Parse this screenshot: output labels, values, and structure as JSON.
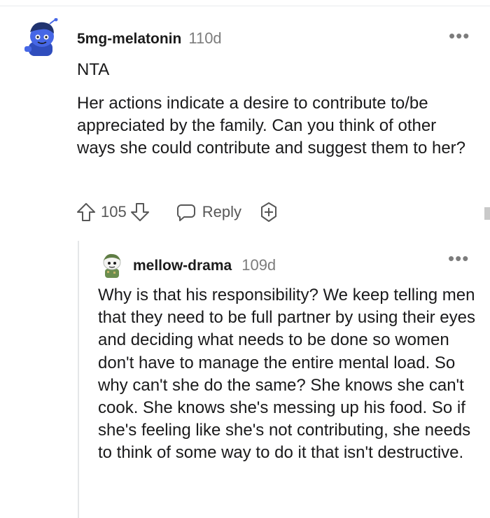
{
  "comment": {
    "username": "5mg-melatonin",
    "age": "110d",
    "verdict": "NTA",
    "body": "Her actions indicate a desire to contribute to/be appreciated by the family. Can you think of other ways she could contribute and suggest them to her?",
    "score": "105",
    "reply_label": "Reply",
    "more_icon": "•••"
  },
  "reply": {
    "username": "mellow-drama",
    "age": "109d",
    "body": "Why is that his responsibility? We keep telling men that they need to be full partner by using their eyes and deciding what needs to be done so women don't have to manage the entire mental load. So why can't she do the same? She knows she can't cook. She knows she's messing up his food. So if she's feeling like she's not contributing, she needs to think of some way to do it that isn't destructive.",
    "more_icon": "•••"
  },
  "icons": {
    "upvote": "upvote-arrow-icon",
    "downvote": "downvote-arrow-icon",
    "reply": "speech-bubble-icon",
    "award": "award-plus-icon",
    "more": "ellipsis-icon"
  },
  "colors": {
    "text": "#1a1a1b",
    "meta": "#7c7c7c",
    "action": "#575757",
    "avatar_blue": "#3d5bd9",
    "thread_line": "#e4e6e8"
  }
}
